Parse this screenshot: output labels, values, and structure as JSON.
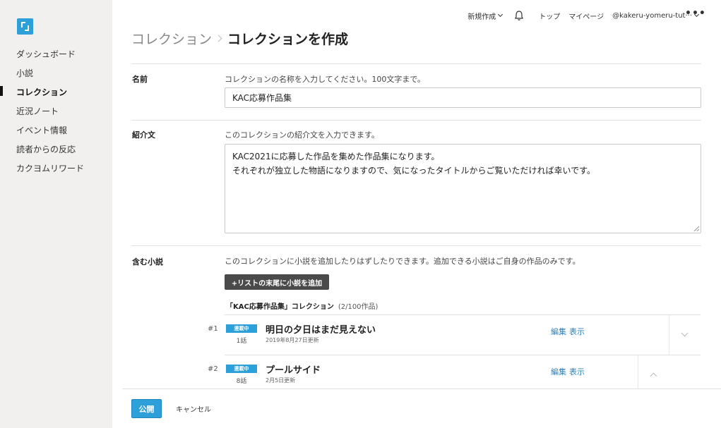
{
  "sidebar": {
    "items": [
      {
        "label": "ダッシュボード"
      },
      {
        "label": "小説"
      },
      {
        "label": "コレクション"
      },
      {
        "label": "近況ノート"
      },
      {
        "label": "イベント情報"
      },
      {
        "label": "読者からの反応"
      },
      {
        "label": "カクヨムリワード"
      }
    ],
    "active_index": 2
  },
  "topbar": {
    "new_label": "新規作成",
    "top_label": "トップ",
    "mypage_label": "マイページ",
    "user_label": "@kakeru-yomeru-tut···",
    "more_glyph": "•••"
  },
  "breadcrumb": {
    "parent": "コレクション",
    "current": "コレクションを作成"
  },
  "form": {
    "name": {
      "label": "名前",
      "help": "コレクションの名称を入力してください。100文字まで。",
      "value": "KAC応募作品集"
    },
    "intro": {
      "label": "紹介文",
      "help": "このコレクションの紹介文を入力できます。",
      "value": "KAC2021に応募した作品を集めた作品集になります。\nそれぞれが独立した物語になりますので、気になったタイトルからご覧いただければ幸いです。"
    },
    "works": {
      "label": "含む小説",
      "help": "このコレクションに小説を追加したりはずしたりできます。追加できる小説はご自身の作品のみです。",
      "add_button": "+リストの末尾に小説を追加",
      "collection_title": "「KAC応募作品集」コレクション",
      "collection_count": "(2/100作品)",
      "items": [
        {
          "num": "#1",
          "status": "連載中",
          "episodes": "1話",
          "title": "明日の夕日はまだ見えない",
          "updated": "2019年8月27日更新",
          "edit": "編集",
          "view": "表示"
        },
        {
          "num": "#2",
          "status": "連載中",
          "episodes": "8話",
          "title": "プールサイド",
          "updated": "2月5日更新",
          "edit": "編集",
          "view": "表示"
        }
      ]
    }
  },
  "footer": {
    "publish": "公開",
    "cancel": "キャンセル"
  },
  "colors": {
    "accent": "#2d9fd9",
    "sidebar_bg": "#f1f0ef",
    "link": "#2d7fb8"
  }
}
